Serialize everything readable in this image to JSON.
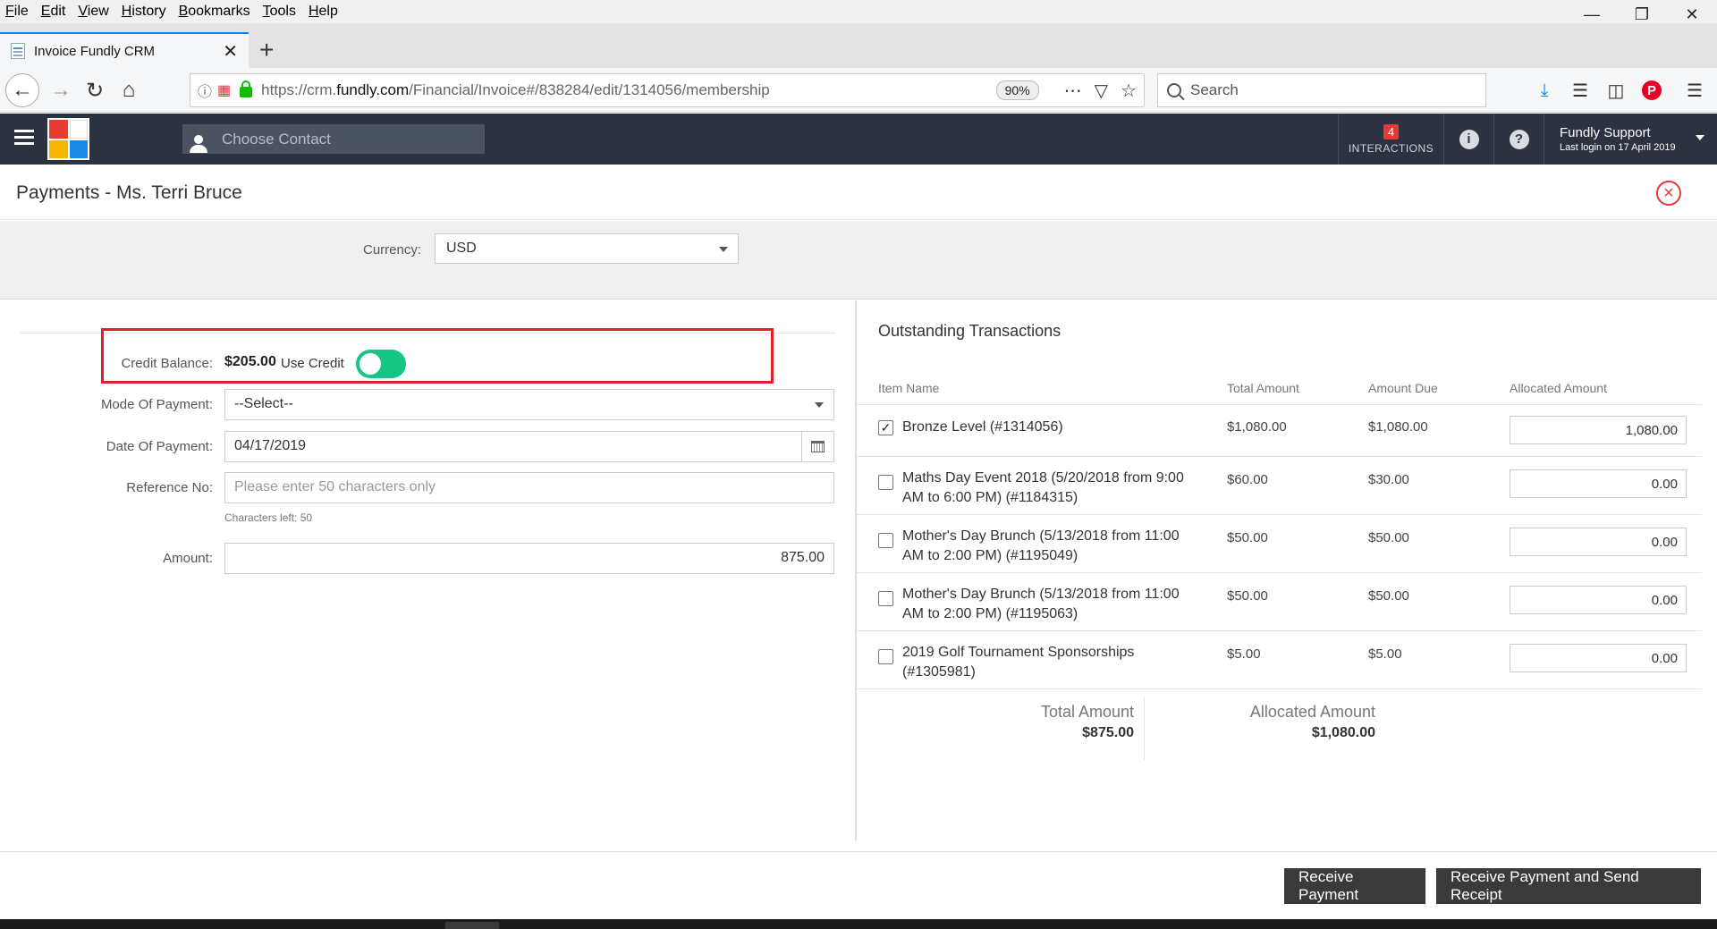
{
  "browser": {
    "menu": [
      "File",
      "Edit",
      "View",
      "History",
      "Bookmarks",
      "Tools",
      "Help"
    ],
    "tab_title": "Invoice Fundly CRM",
    "url_prefix": "https://crm.",
    "url_domain": "fundly.com",
    "url_path": "/Financial/Invoice#/838284/edit/1314056/membership",
    "zoom": "90%",
    "search_placeholder": "Search"
  },
  "app": {
    "contact_placeholder": "Choose Contact",
    "interactions_count": "4",
    "interactions_label": "INTERACTIONS",
    "user_name": "Fundly Support",
    "last_login": "Last login on 17 April 2019",
    "colors": {
      "header": "#2c3240",
      "toggle_on": "#17c684",
      "badge": "#e53935",
      "highlight": "#e2202c"
    }
  },
  "page": {
    "title": "Payments - Ms. Terri Bruce",
    "currency_label": "Currency:",
    "currency_value": "USD"
  },
  "form": {
    "credit_label": "Credit Balance:",
    "credit_value": "$205.00",
    "use_credit_label": "Use Credit",
    "use_credit_on": true,
    "mode_label": "Mode Of Payment:",
    "mode_value": "--Select--",
    "date_label": "Date Of Payment:",
    "date_value": "04/17/2019",
    "ref_label": "Reference No:",
    "ref_placeholder": "Please enter 50 characters only",
    "chars_left": "Characters left: 50",
    "amount_label": "Amount:",
    "amount_value": "875.00"
  },
  "transactions": {
    "title": "Outstanding Transactions",
    "headers": [
      "Item Name",
      "Total Amount",
      "Amount Due",
      "Allocated Amount"
    ],
    "rows": [
      {
        "checked": true,
        "name": "Bronze Level (#1314056)",
        "total": "$1,080.00",
        "due": "$1,080.00",
        "allocated": "1,080.00"
      },
      {
        "checked": false,
        "name": "Maths Day Event 2018 (5/20/2018 from 9:00 AM to 6:00 PM) (#1184315)",
        "total": "$60.00",
        "due": "$30.00",
        "allocated": "0.00"
      },
      {
        "checked": false,
        "name": "Mother's Day Brunch (5/13/2018 from 11:00 AM to 2:00 PM) (#1195049)",
        "total": "$50.00",
        "due": "$50.00",
        "allocated": "0.00"
      },
      {
        "checked": false,
        "name": "Mother's Day Brunch (5/13/2018 from 11:00 AM to 2:00 PM) (#1195063)",
        "total": "$50.00",
        "due": "$50.00",
        "allocated": "0.00"
      },
      {
        "checked": false,
        "name": "2019 Golf Tournament Sponsorships (#1305981)",
        "total": "$5.00",
        "due": "$5.00",
        "allocated": "0.00"
      }
    ],
    "total_label": "Total Amount",
    "total_value": "$875.00",
    "allocated_label": "Allocated Amount",
    "allocated_value": "$1,080.00"
  },
  "footer": {
    "receive_label": "Receive Payment",
    "receive_send_label": "Receive Payment and Send Receipt"
  }
}
